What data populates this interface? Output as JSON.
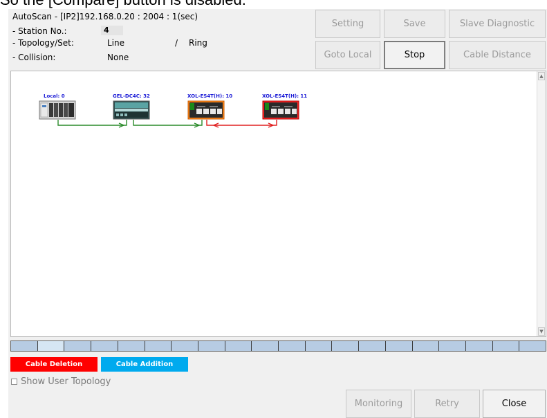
{
  "caption_text": "So the [Compare] button is disabled.",
  "dialog": {
    "title": "AutoScan - [IP2]192.168.0.20 : 2004 : 1(sec)",
    "station_label": "- Station No.:",
    "station_value": "4",
    "topology_label": "- Topology/Set:",
    "topology_value": "Line",
    "topology_sep": "/",
    "topology_set": "Ring",
    "collision_label": "- Collision:",
    "collision_value": "None"
  },
  "buttons": {
    "setting": "Setting",
    "save": "Save",
    "slave_diagnostic": "Slave Diagnostic",
    "goto_local": "Goto Local",
    "stop": "Stop",
    "cable_distance": "Cable Distance",
    "monitoring": "Monitoring",
    "retry": "Retry",
    "close": "Close"
  },
  "devices": [
    {
      "label": "Local: 0",
      "type": "plc"
    },
    {
      "label": "GEL-DC4C: 32",
      "type": "io-module"
    },
    {
      "label": "XOL-ES4T(H): 10",
      "type": "switch-orange"
    },
    {
      "label": "XOL-ES4T(H): 11",
      "type": "switch-red"
    }
  ],
  "links": [
    {
      "from": 0,
      "to": 1,
      "status": "ok",
      "color": "#2a8a2a"
    },
    {
      "from": 1,
      "to": 2,
      "status": "ok",
      "color": "#2a8a2a"
    },
    {
      "from": 2,
      "to": 3,
      "status": "deleted",
      "color": "#e02020"
    }
  ],
  "legend": {
    "deletion_label": "Cable Deletion",
    "deletion_color": "#ff0000",
    "addition_label": "Cable Addition",
    "addition_color": "#00aaee"
  },
  "progress": {
    "segments": 20,
    "selected_index": 1
  },
  "options": {
    "show_user_topology_label": "Show User Topology",
    "show_user_topology_checked": false
  }
}
